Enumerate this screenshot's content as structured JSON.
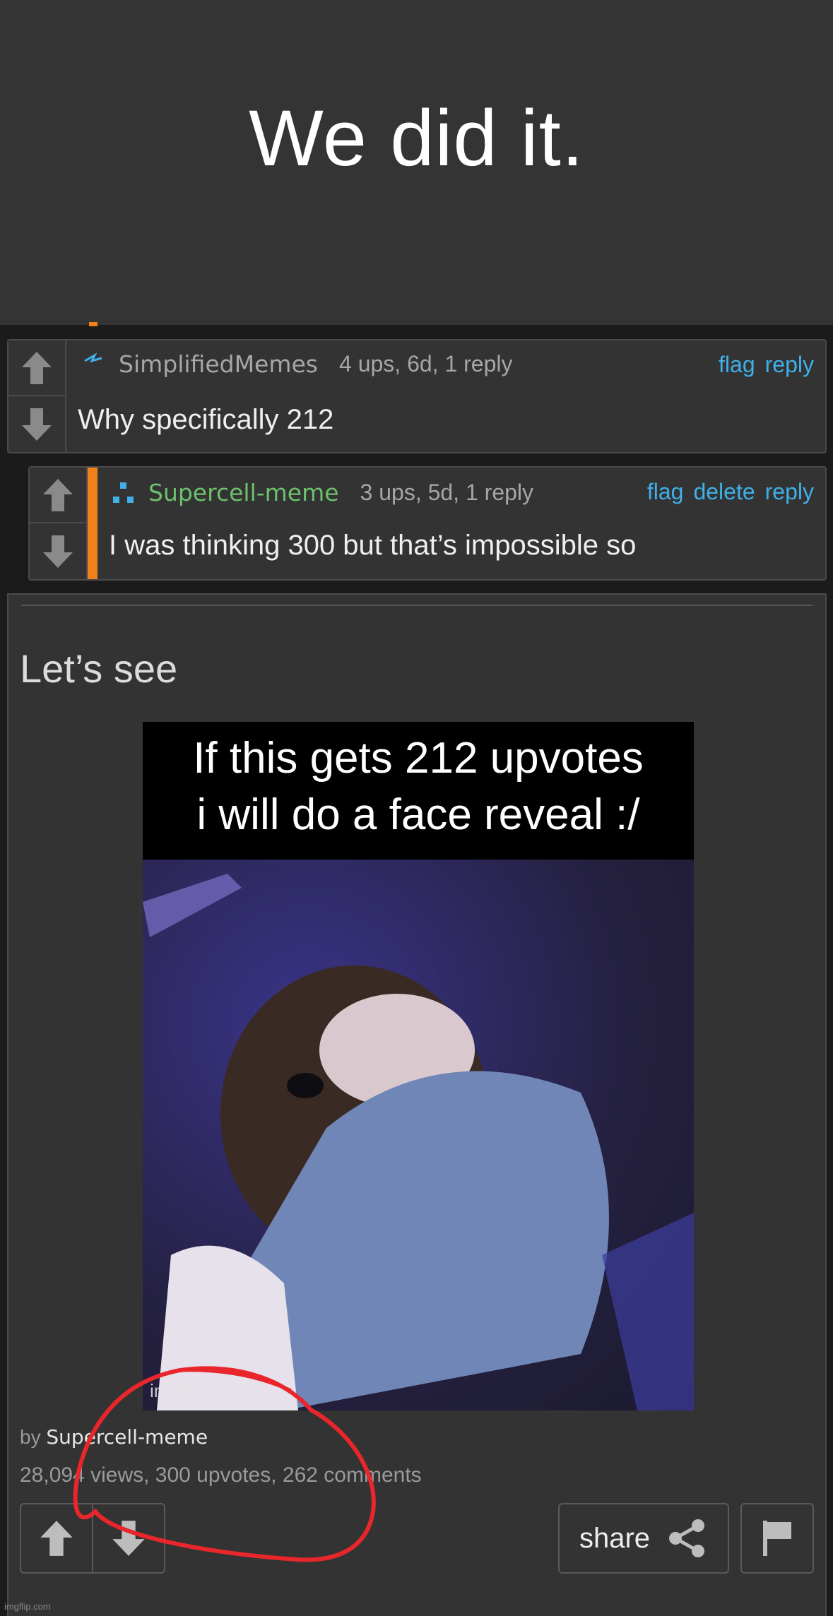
{
  "caption": "We did it.",
  "comments": [
    {
      "username": "SimplifiedMemes",
      "stats": "4 ups, 6d, 1 reply",
      "actions": [
        "flag",
        "reply"
      ],
      "text": "Why specifically 212"
    },
    {
      "username": "Supercell-meme",
      "stats": "3 ups, 5d, 1 reply",
      "actions": [
        "flag",
        "delete",
        "reply"
      ],
      "text": "I was thinking 300 but that’s impossible so"
    }
  ],
  "post": {
    "title": "Let’s see",
    "meme_caption_line1": "If this gets 212 upvotes",
    "meme_caption_line2": "i will do a face reveal :/",
    "meme_watermark": "imgflip.com",
    "by_prefix": "by",
    "author": "Supercell-meme",
    "stats": "28,094 views, 300 upvotes, 262 comments",
    "share_label": "share"
  },
  "site_watermark": "imgflip.com",
  "colors": {
    "accent_link": "#3fb0e8",
    "op_orange": "#f0801a",
    "username_green": "#6cc16c",
    "annotation_red": "#e8262b"
  }
}
